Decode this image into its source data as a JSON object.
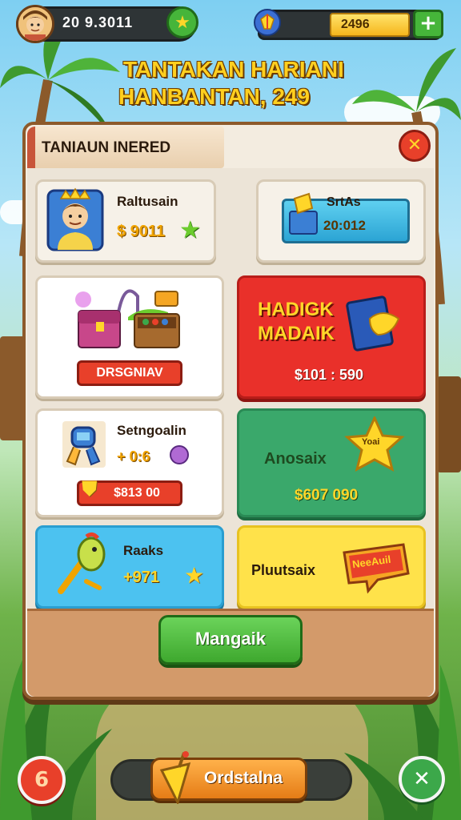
{
  "hud": {
    "player_value": "20 9.3011",
    "currency_value": "2496",
    "star_icon": "star-icon",
    "gem_icon": "gem-icon",
    "plus_label": "+"
  },
  "headline": {
    "line1": "TANTAKAN HARIANI",
    "line2": "HANBANTAN, 249"
  },
  "panel": {
    "title": "TANIAUN INERED",
    "close_label": "✕"
  },
  "cards": {
    "profile": {
      "name": "Raltusain",
      "value": "$ 9011"
    },
    "blue_item": {
      "name": "SrtAs",
      "value": "20:012"
    },
    "chests": {
      "button": "DRSGNIAV"
    },
    "red_offer": {
      "title_line1": "HADIGK",
      "title_line2": "MADAIK",
      "price": "$101 : 590"
    },
    "tool": {
      "name": "Setngoalin",
      "value": "+ 0:6",
      "button": "$813 00"
    },
    "green_offer": {
      "name": "Anosaix",
      "badge": "Yoai",
      "price": "$607 090"
    },
    "rake": {
      "name": "Raaks",
      "value": "+971"
    },
    "yellow_offer": {
      "name": "Pluutsaix",
      "badge": "NeeAuil"
    }
  },
  "actions": {
    "manage": "Mangaik",
    "bottom": "Ordstalna",
    "left_round": "6",
    "right_round": "✕"
  },
  "colors": {
    "accent_gold": "#ffcf1f",
    "red": "#e9302a",
    "green": "#3aa86b",
    "blue": "#4cc2f0",
    "yellow": "#ffe24a"
  }
}
